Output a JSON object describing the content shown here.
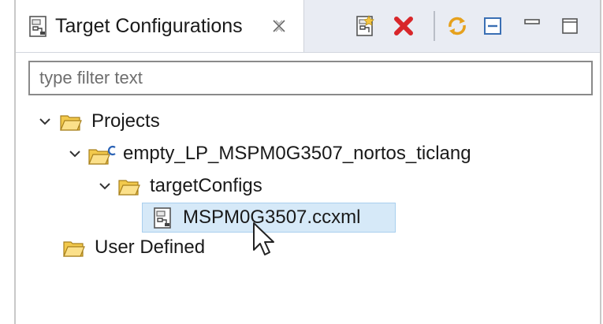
{
  "view": {
    "title": "Target Configurations",
    "filter_placeholder": "type filter text"
  },
  "toolbar": {
    "buttons": [
      "new-target-config-icon",
      "delete-icon",
      "refresh-icon",
      "collapse-all-icon",
      "minimize-icon",
      "maximize-icon"
    ]
  },
  "tree": {
    "projects_label": "Projects",
    "project_label": "empty_LP_MSPM0G3507_nortos_ticlang",
    "folder_label": "targetConfigs",
    "file_label": "MSPM0G3507.ccxml",
    "user_defined_label": "User Defined"
  },
  "colors": {
    "selection": "#d6e9f8",
    "folder": "#f2c94c",
    "delete": "#d8262a"
  }
}
